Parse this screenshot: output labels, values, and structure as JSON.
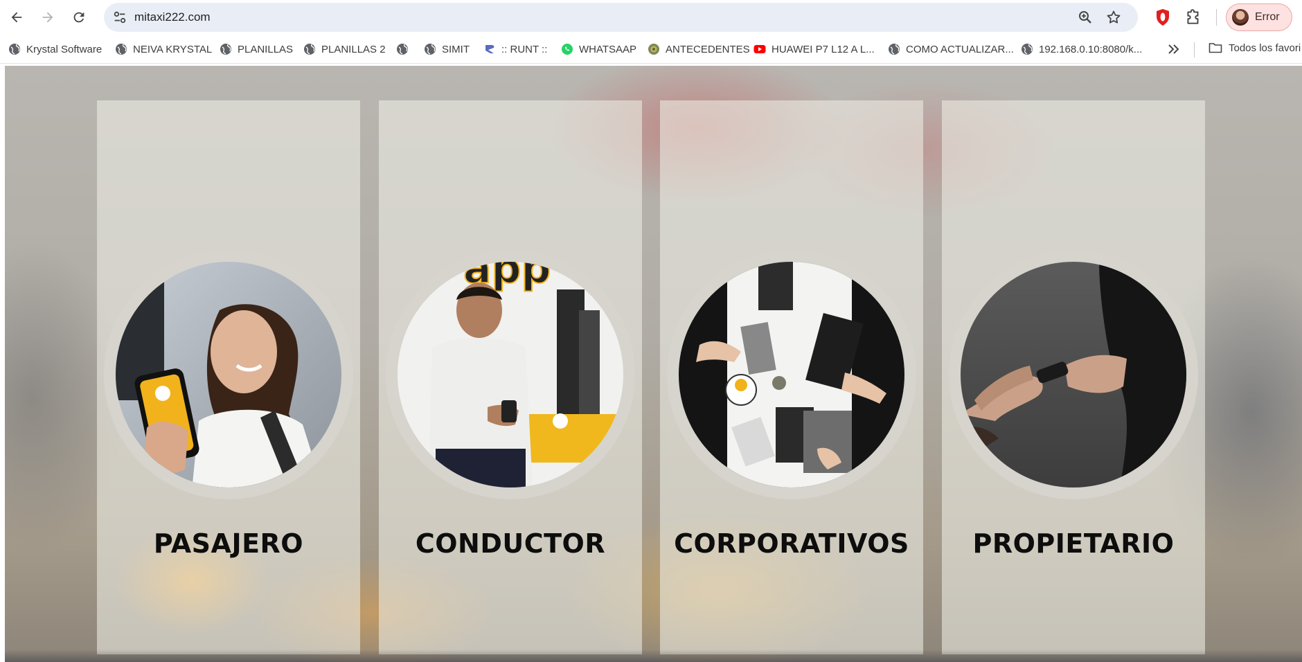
{
  "browser": {
    "url": "mitaxi222.com",
    "profile_label": "Error",
    "icons": {
      "back": "arrow-left-icon",
      "forward": "arrow-right-icon",
      "reload": "reload-icon",
      "site_info": "tune-icon",
      "zoom": "zoom-icon",
      "bookmark": "star-icon",
      "extension": "opera-icon",
      "extensions_menu": "puzzle-icon"
    }
  },
  "bookmarks": {
    "items": [
      {
        "label": "Krystal Software",
        "icon": "globe-icon"
      },
      {
        "label": "NEIVA KRYSTAL",
        "icon": "globe-icon"
      },
      {
        "label": "PLANILLAS",
        "icon": "globe-icon"
      },
      {
        "label": "PLANILLAS 2",
        "icon": "globe-icon"
      },
      {
        "label": "",
        "icon": "globe-icon"
      },
      {
        "label": "SIMIT",
        "icon": "globe-icon"
      },
      {
        "label": ":: RUNT ::",
        "icon": "runt-icon"
      },
      {
        "label": "WHATSAAP",
        "icon": "whatsapp-icon"
      },
      {
        "label": "ANTECEDENTES",
        "icon": "seal-icon"
      },
      {
        "label": "HUAWEI P7 L12 A L...",
        "icon": "youtube-icon"
      },
      {
        "label": "COMO ACTUALIZAR...",
        "icon": "globe-icon"
      },
      {
        "label": "192.168.0.10:8080/k...",
        "icon": "globe-icon"
      }
    ],
    "folder_label": "Todos los favori"
  },
  "page": {
    "cards": [
      {
        "title": "PASAJERO"
      },
      {
        "title": "CONDUCTOR"
      },
      {
        "title": "CORPORATIVOS"
      },
      {
        "title": "PROPIETARIO"
      }
    ]
  }
}
